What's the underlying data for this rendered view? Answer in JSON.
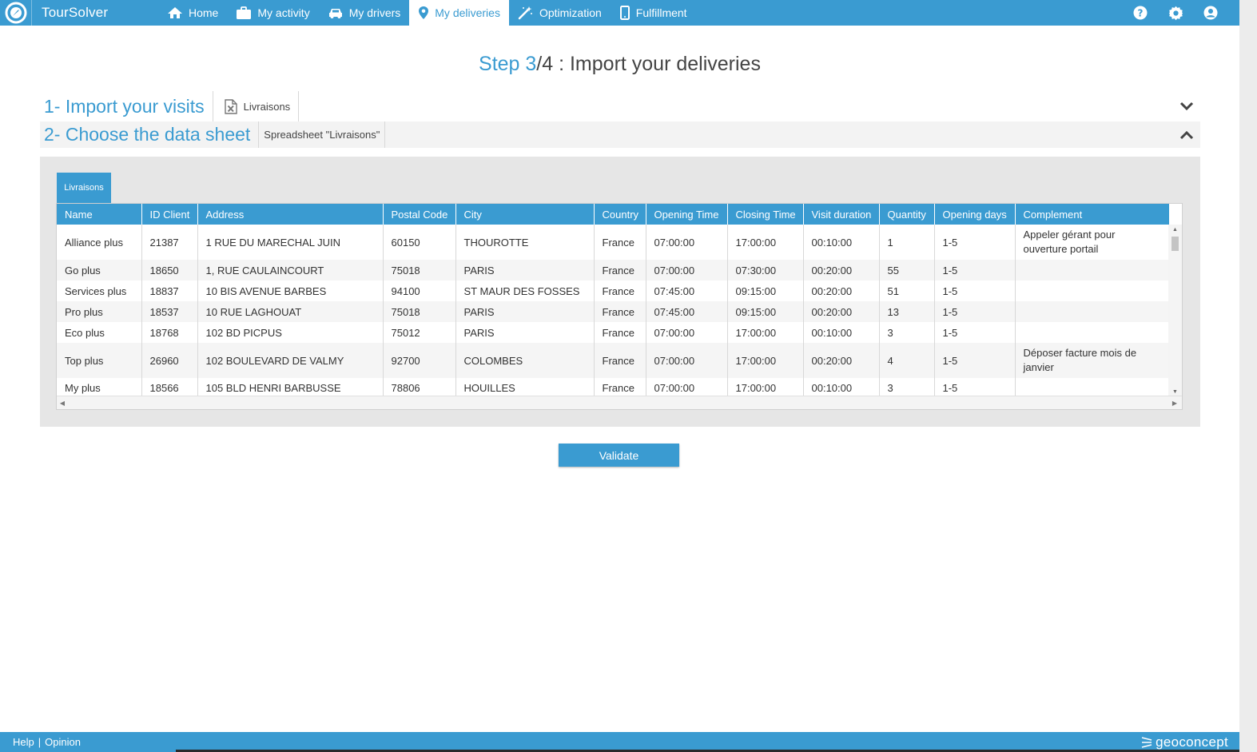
{
  "brand": {
    "name": "TourSolver"
  },
  "nav": {
    "items": [
      {
        "label": "Home",
        "icon": "home-icon",
        "active": false
      },
      {
        "label": "My activity",
        "icon": "briefcase-icon",
        "active": false
      },
      {
        "label": "My drivers",
        "icon": "car-icon",
        "active": false
      },
      {
        "label": "My deliveries",
        "icon": "map-pin-icon",
        "active": true
      },
      {
        "label": "Optimization",
        "icon": "magic-wand-icon",
        "active": false
      },
      {
        "label": "Fulfillment",
        "icon": "mobile-phone-icon",
        "active": false
      }
    ],
    "right_icons": [
      "help-icon",
      "gear-icon",
      "user-icon"
    ]
  },
  "title": {
    "step": "Step 3",
    "rest": "/4 : Import your deliveries"
  },
  "section1": {
    "heading": "1- Import your visits",
    "file_name": "Livraisons"
  },
  "section2": {
    "heading": "2- Choose the data sheet",
    "sheet_label": "Spreadsheet \"Livraisons\""
  },
  "sheet_tab": "Livraisons",
  "table": {
    "columns": [
      "Name",
      "ID Client",
      "Address",
      "Postal Code",
      "City",
      "Country",
      "Opening Time",
      "Closing Time",
      "Visit duration",
      "Quantity",
      "Opening days",
      "Complement"
    ],
    "rows": [
      [
        "Alliance plus",
        "21387",
        "1 RUE DU MARECHAL JUIN",
        "60150",
        "THOUROTTE",
        "France",
        "07:00:00",
        "17:00:00",
        "00:10:00",
        "1",
        "1-5",
        "Appeler gérant pour ouverture portail"
      ],
      [
        "Go plus",
        "18650",
        "1, RUE CAULAINCOURT",
        "75018",
        "PARIS",
        "France",
        "07:00:00",
        "07:30:00",
        "00:20:00",
        "55",
        "1-5",
        ""
      ],
      [
        "Services plus",
        "18837",
        "10 BIS AVENUE BARBES",
        "94100",
        "ST MAUR DES FOSSES",
        "France",
        "07:45:00",
        "09:15:00",
        "00:20:00",
        "51",
        "1-5",
        ""
      ],
      [
        "Pro plus",
        "18537",
        "10 RUE LAGHOUAT",
        "75018",
        "PARIS",
        "France",
        "07:45:00",
        "09:15:00",
        "00:20:00",
        "13",
        "1-5",
        ""
      ],
      [
        "Eco plus",
        "18768",
        "102 BD PICPUS",
        "75012",
        "PARIS",
        "France",
        "07:00:00",
        "17:00:00",
        "00:10:00",
        "3",
        "1-5",
        ""
      ],
      [
        "Top plus",
        "26960",
        "102 BOULEVARD DE VALMY",
        "92700",
        "COLOMBES",
        "France",
        "07:00:00",
        "17:00:00",
        "00:20:00",
        "4",
        "1-5",
        "Déposer facture mois de janvier"
      ],
      [
        "My plus",
        "18566",
        "105 BLD HENRI BARBUSSE",
        "78806",
        "HOUILLES",
        "France",
        "07:00:00",
        "17:00:00",
        "00:10:00",
        "3",
        "1-5",
        ""
      ]
    ]
  },
  "validate_label": "Validate",
  "footer": {
    "help": "Help",
    "separator": "|",
    "opinion": "Opinion",
    "brand": "geoconcept"
  },
  "colors": {
    "accent": "#3a9bd1",
    "panel": "#e6e6e6"
  }
}
